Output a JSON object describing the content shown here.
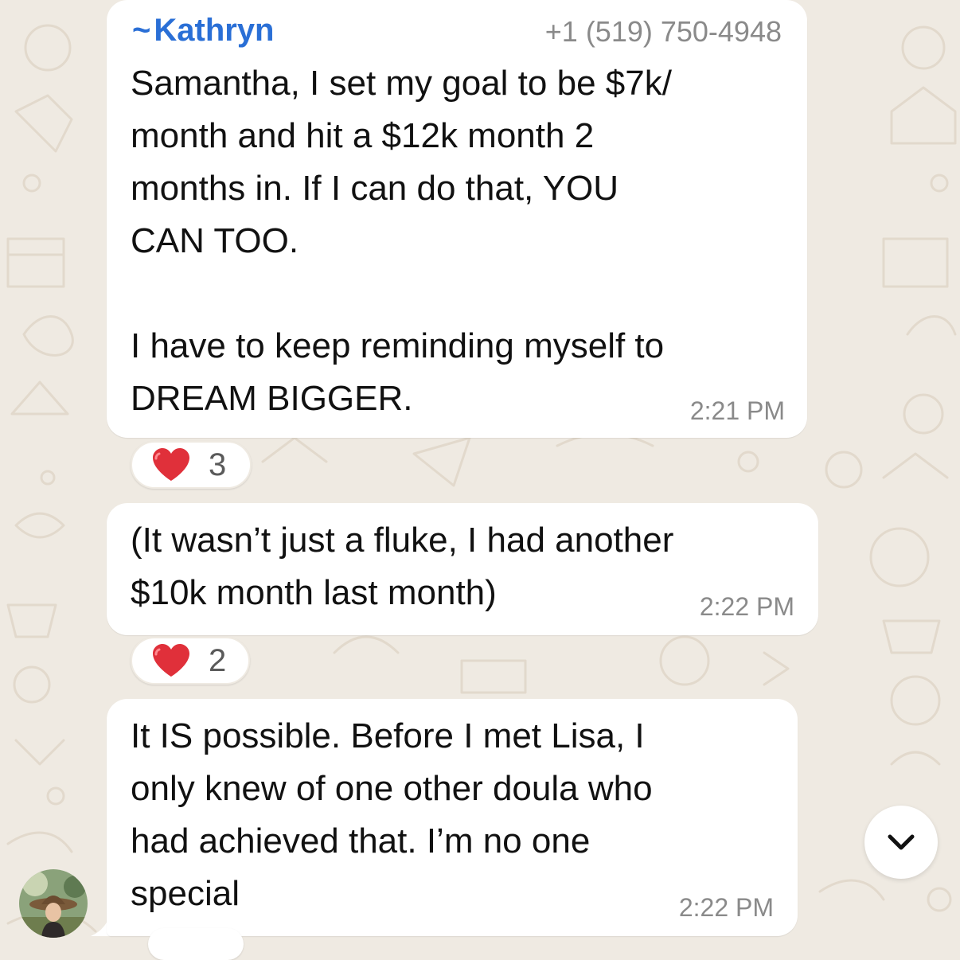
{
  "colors": {
    "wallpaper": "#efeae2",
    "bubble": "#ffffff",
    "sender_name": "#2a6fd6",
    "timestamp": "#8a8a8a",
    "heart": "#e0303a"
  },
  "messages": [
    {
      "sender_prefix": "~",
      "sender_name": "Kathryn",
      "sender_phone": "+1 (519) 750-4948",
      "text": "Samantha, I set my goal to be $7k/\nmonth and hit a $12k month 2\nmonths in. If I can do that, YOU\nCAN TOO.\n\nI have to keep reminding myself to\nDREAM BIGGER.",
      "time": "2:21 PM",
      "reaction": {
        "emoji": "heart-emoji",
        "count": "3"
      }
    },
    {
      "text": "(It wasn’t just a fluke, I had another\n$10k month last month)",
      "time": "2:22 PM",
      "reaction": {
        "emoji": "heart-emoji",
        "count": "2"
      }
    },
    {
      "text": "It IS possible. Before I met Lisa, I\nonly knew of one other doula who\nhad achieved that. I’m no one\nspecial",
      "time": "2:22 PM"
    }
  ],
  "avatar_icon": "sender-avatar-photo",
  "scroll_button_icon": "chevron-down-icon"
}
